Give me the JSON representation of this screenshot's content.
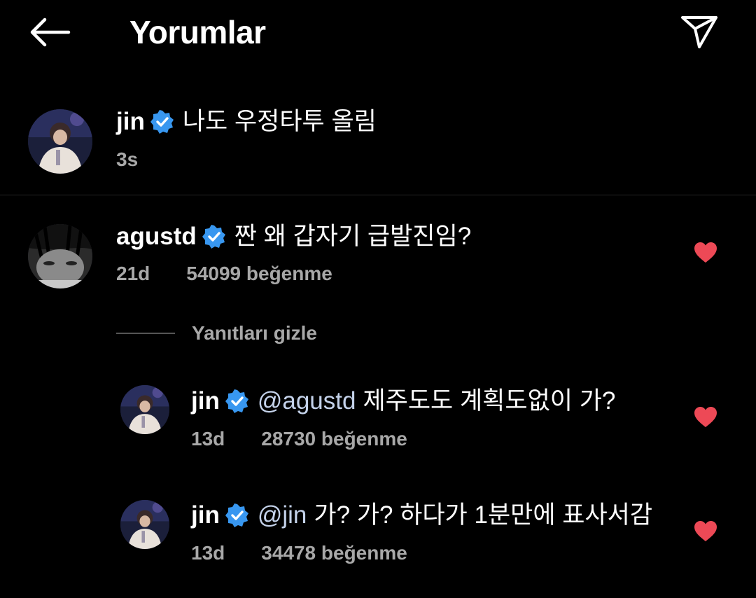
{
  "header": {
    "title": "Yorumlar"
  },
  "caption": {
    "username": "jin",
    "text": "나도 우정타투 올림",
    "time": "3s"
  },
  "comments": [
    {
      "username": "agustd",
      "text": "짠 왜 갑자기 급발진임?",
      "time": "21d",
      "likes": "54099 beğenme"
    }
  ],
  "hide_replies": "Yanıtları gizle",
  "replies": [
    {
      "username": "jin",
      "mention": "@agustd",
      "text": "제주도도 계획도없이 가?",
      "time": "13d",
      "likes": "28730 beğenme"
    },
    {
      "username": "jin",
      "mention": "@jin",
      "text": "가? 가? 하다가 1분만에 표사서감",
      "time": "13d",
      "likes": "34478 beğenme"
    }
  ],
  "colors": {
    "background": "#000000",
    "verified": "#3897f0",
    "heart": "#ed4956",
    "secondary_text": "#a8a8a8",
    "mention": "#c4d2ea"
  },
  "icons": {
    "back": "arrow-left-icon",
    "share": "paper-plane-icon",
    "verified": "verified-badge-icon",
    "like": "heart-filled-icon"
  }
}
